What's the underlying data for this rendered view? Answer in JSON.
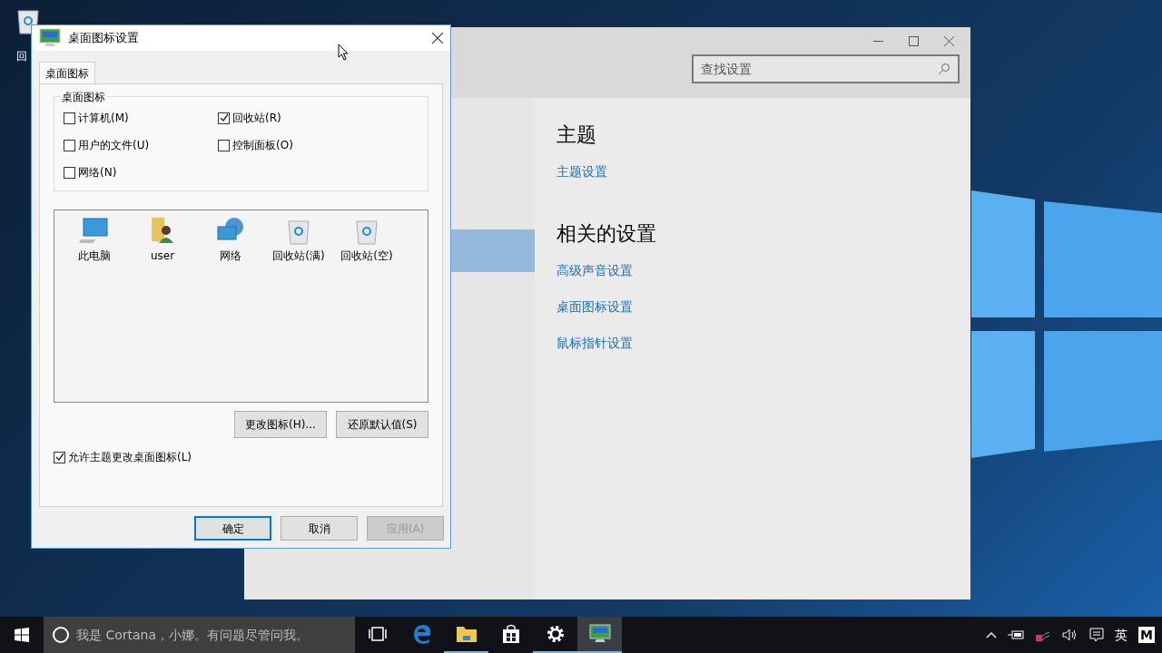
{
  "desktop_icons": [
    {
      "label": "回"
    }
  ],
  "settings_window": {
    "search": {
      "placeholder": "查找设置"
    },
    "sidebar": {
      "items": [
        {
          "selected": true
        }
      ]
    },
    "sections": [
      {
        "heading": "主题",
        "links": [
          "主题设置"
        ]
      },
      {
        "heading": "相关的设置",
        "links": [
          "高级声音设置",
          "桌面图标设置",
          "鼠标指针设置"
        ]
      }
    ]
  },
  "dialog": {
    "title": "桌面图标设置",
    "tabs": [
      {
        "label": "桌面图标",
        "selected": true
      }
    ],
    "group_title": "桌面图标",
    "checkboxes": [
      {
        "label": "计算机(M)",
        "checked": false
      },
      {
        "label": "回收站(R)",
        "checked": true
      },
      {
        "label": "用户的文件(U)",
        "checked": false
      },
      {
        "label": "控制面板(O)",
        "checked": false
      },
      {
        "label": "网络(N)",
        "checked": false
      }
    ],
    "icons": [
      {
        "label": "此电脑",
        "kind": "computer"
      },
      {
        "label": "user",
        "kind": "user"
      },
      {
        "label": "网络",
        "kind": "network"
      },
      {
        "label": "回收站(满)",
        "kind": "recycle"
      },
      {
        "label": "回收站(空)",
        "kind": "recycle"
      }
    ],
    "icon_buttons": [
      "更改图标(H)...",
      "还原默认值(S)"
    ],
    "allow_themes": {
      "label": "允许主题更改桌面图标(L)",
      "checked": true
    },
    "buttons": [
      {
        "label": "确定",
        "default": true,
        "disabled": false
      },
      {
        "label": "取消",
        "default": false,
        "disabled": false
      },
      {
        "label": "应用(A)",
        "default": false,
        "disabled": true
      }
    ]
  },
  "taskbar": {
    "search": {
      "placeholder": "我是 Cortana，小娜。有问题尽管问我。"
    },
    "apps": [
      {
        "kind": "taskview",
        "running": false,
        "selected": false
      },
      {
        "kind": "edge",
        "running": false,
        "selected": false
      },
      {
        "kind": "explorer",
        "running": true,
        "selected": false
      },
      {
        "kind": "store",
        "running": false,
        "selected": false
      },
      {
        "kind": "settings",
        "running": true,
        "selected": false
      },
      {
        "kind": "display",
        "running": true,
        "selected": true
      }
    ],
    "tray": {
      "ime": "英",
      "ime_mode": "M"
    }
  }
}
